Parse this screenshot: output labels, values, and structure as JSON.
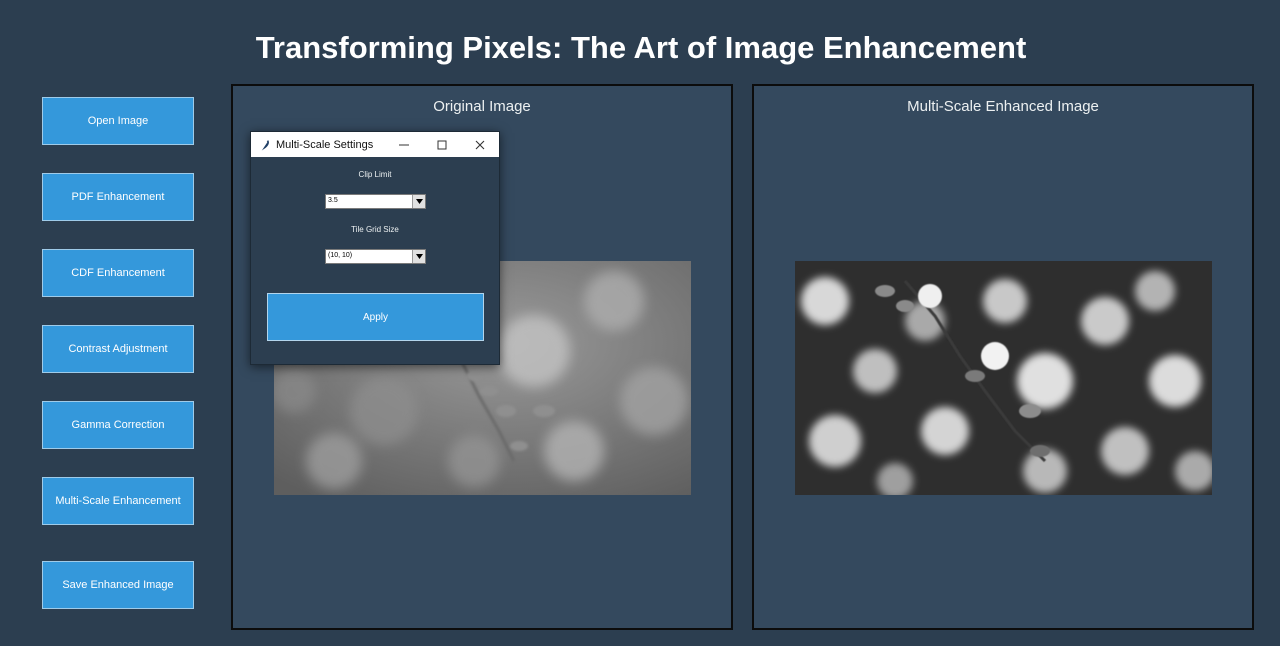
{
  "app": {
    "title": "Transforming Pixels: The Art of Image Enhancement"
  },
  "sidebar": {
    "buttons": [
      {
        "label": "Open Image"
      },
      {
        "label": "PDF Enhancement"
      },
      {
        "label": "CDF Enhancement"
      },
      {
        "label": "Contrast Adjustment"
      },
      {
        "label": "Gamma Correction"
      },
      {
        "label": "Multi-Scale Enhancement"
      },
      {
        "label": "Save Enhanced Image"
      }
    ]
  },
  "panels": {
    "original": {
      "title": "Original Image"
    },
    "enhanced": {
      "title": "Multi-Scale Enhanced Image"
    }
  },
  "dialog": {
    "title": "Multi-Scale Settings",
    "clip_limit_label": "Clip Limit",
    "clip_limit_value": "3.5",
    "tile_grid_label": "Tile Grid Size",
    "tile_grid_value": "(10, 10)",
    "apply_label": "Apply"
  },
  "colors": {
    "background": "#2c3e50",
    "panel": "#34495e",
    "accent": "#3498db"
  },
  "icons": {
    "window": "feather-icon",
    "minimize": "minimize-icon",
    "maximize": "maximize-icon",
    "close": "close-icon",
    "dropdown": "dropdown-arrow-icon"
  }
}
